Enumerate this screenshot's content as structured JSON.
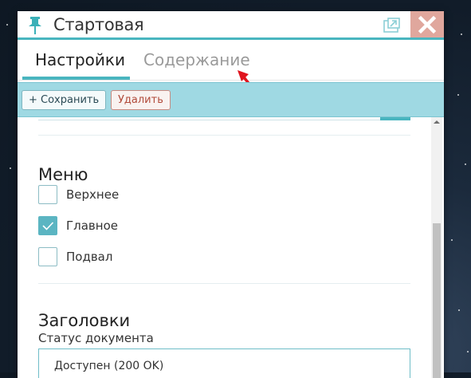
{
  "window": {
    "title": "Стартовая",
    "icons": {
      "pin": "pin-icon",
      "popout": "popout-icon",
      "close": "close-icon"
    }
  },
  "tabs": [
    {
      "label": "Настройки",
      "active": true
    },
    {
      "label": "Содержание",
      "active": false
    }
  ],
  "toolbar": {
    "save_label": "+ Сохранить",
    "delete_label": "Удалить"
  },
  "menu_section": {
    "heading": "Меню",
    "options": [
      {
        "label": "Верхнее",
        "checked": false
      },
      {
        "label": "Главное",
        "checked": true
      },
      {
        "label": "Подвал",
        "checked": false
      }
    ]
  },
  "headers_section": {
    "heading": "Заголовки",
    "status_label": "Статус документа",
    "status_value": "Доступен (200 OK)"
  },
  "colors": {
    "accent": "#49b5bf",
    "toolbar_bg": "#9fd9e3",
    "close_bg": "#e0a79d",
    "delete_text": "#b14a3a",
    "annotation_arrow": "#e0141e"
  }
}
